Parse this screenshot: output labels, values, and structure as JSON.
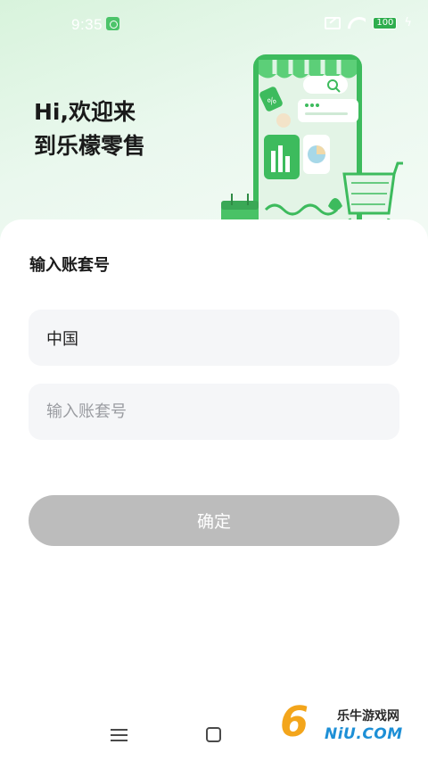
{
  "status_bar": {
    "time": "9:35",
    "battery": "100"
  },
  "greeting": {
    "line1": "Hi,欢迎来",
    "line2": "到乐檬零售"
  },
  "form": {
    "section_label": "输入账套号",
    "country_value": "中国",
    "account_placeholder": "输入账套号",
    "account_value": "",
    "confirm_label": "确定"
  },
  "watermark": {
    "number": "6",
    "text_cn": "乐牛游戏网",
    "text_en": "NiU.COM"
  },
  "colors": {
    "accent_green": "#3dbb5d",
    "button_disabled": "#bcbcbc",
    "field_bg": "#f5f6f8"
  }
}
